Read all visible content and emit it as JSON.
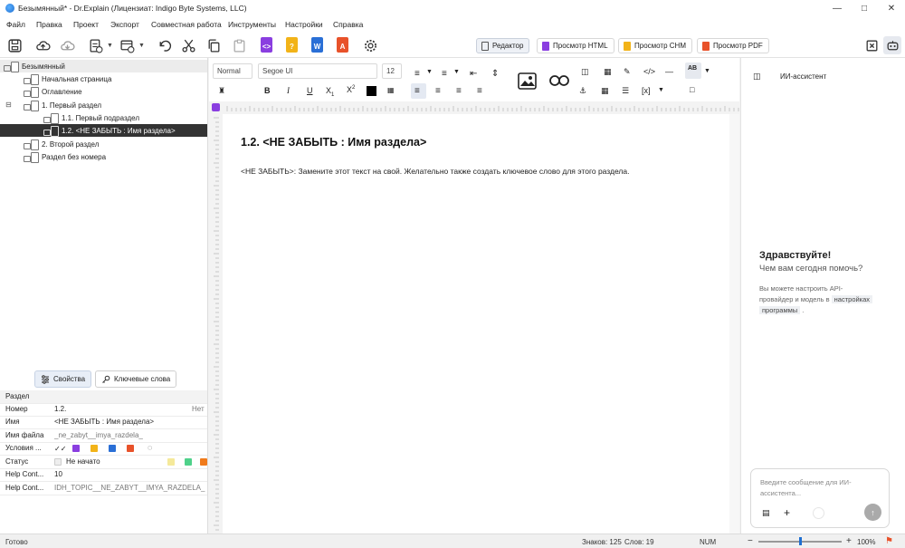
{
  "window": {
    "title": "Безымянный* - Dr.Explain (Лицензиат: Indigo Byte Systems, LLC)"
  },
  "menu": [
    "Файл",
    "Правка",
    "Проект",
    "Экспорт",
    "Совместная работа",
    "Инструменты",
    "Настройки",
    "Справка"
  ],
  "view_modes": [
    "Редактор",
    "Просмотр HTML",
    "Просмотр CHM",
    "Просмотр PDF"
  ],
  "tree": [
    {
      "label": "Безымянный"
    },
    {
      "label": "Начальная страница"
    },
    {
      "label": "Оглавление"
    },
    {
      "label": "1. Первый раздел"
    },
    {
      "label": "1.1. Первый подраздел"
    },
    {
      "label": "1.2. <НЕ ЗАБЫТЬ : Имя раздела>"
    },
    {
      "label": "2. Второй раздел"
    },
    {
      "label": "Раздел без номера"
    }
  ],
  "props_tabs": [
    "Свойства",
    "Ключевые слова"
  ],
  "properties": {
    "section_header": "Раздел",
    "number_label": "Номер",
    "number_value": "1.2.",
    "number_none": "Нет",
    "name_label": "Имя",
    "name_value": "<НЕ ЗАБЫТЬ : Имя раздела>",
    "file_label": "Имя файла",
    "file_value": "_ne_zabyt__imya_razdela_",
    "cond_label": "Условия ...",
    "status_label": "Статус",
    "status_value": "Не начато",
    "helpctx_label": "Help Cont...",
    "helpctx_value": "10",
    "helpctx2_label": "Help Cont...",
    "helpctx2_value": "IDH_TOPIC__NE_ZABYT__IMYA_RAZDELA_"
  },
  "editor_toolbar": {
    "style": "Normal",
    "font": "Segoe UI",
    "size": "12"
  },
  "document": {
    "title": "1.2.  <НЕ ЗАБЫТЬ : Имя раздела>",
    "body": "<НЕ ЗАБЫТЬ>: Замените этот текст на свой. Желательно также создать ключевое слово для этого раздела."
  },
  "assistant": {
    "title": "ИИ-ассистент",
    "greeting": "Здравствуйте!",
    "subgreeting": "Чем вам сегодня помочь?",
    "hint_part1": "Вы можете настроить API-",
    "hint_part2": "провайдер и модель в",
    "hint_link1": "настройках",
    "hint_link2": "программы",
    "hint_end": ".",
    "input_placeholder": "Введите сообщение для ИИ-ассистента..."
  },
  "status": {
    "ready": "Готово",
    "chars": "Знаков: 125",
    "words": "Слов: 19",
    "num": "NUM",
    "zoom": "100%"
  },
  "colors": {
    "html": "#8a3ee0",
    "chm": "#f2b318",
    "word": "#2a6fd6",
    "pdf": "#e8522a",
    "selection": "#333333"
  }
}
